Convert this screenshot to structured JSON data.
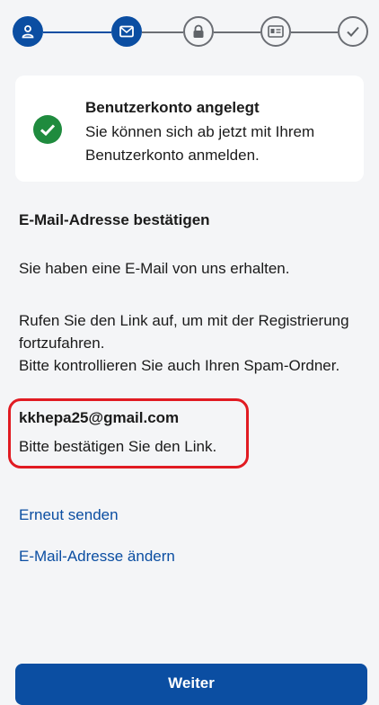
{
  "colors": {
    "primary": "#0b4ea2",
    "success": "#1f8b3e",
    "highlight": "#e11b22",
    "pending_step": "#6b6e74"
  },
  "stepper": {
    "steps": [
      {
        "icon": "user-icon",
        "state": "completed"
      },
      {
        "icon": "mail-icon",
        "state": "current"
      },
      {
        "icon": "lock-icon",
        "state": "pending"
      },
      {
        "icon": "id-card-icon",
        "state": "pending"
      },
      {
        "icon": "check-icon",
        "state": "pending"
      }
    ]
  },
  "success_card": {
    "icon": "check-circle-icon",
    "title": "Benutzerkonto angelegt",
    "message": "Sie können sich ab jetzt mit Ihrem Benutzerkonto anmelden."
  },
  "content": {
    "heading": "E-Mail-Adresse bestätigen",
    "received": "Sie haben eine E-Mail von uns erhalten.",
    "instructions": "Rufen Sie den Link auf, um mit der Registrierung fortzufahren.",
    "spam_hint": "Bitte kontrollieren Sie auch Ihren Spam-Ordner.",
    "email": "kkhepa25@gmail.com",
    "confirm_prompt": "Bitte bestätigen Sie den Link."
  },
  "links": {
    "resend": "Erneut senden",
    "change_email": "E-Mail-Adresse ändern"
  },
  "footer": {
    "continue_label": "Weiter"
  }
}
